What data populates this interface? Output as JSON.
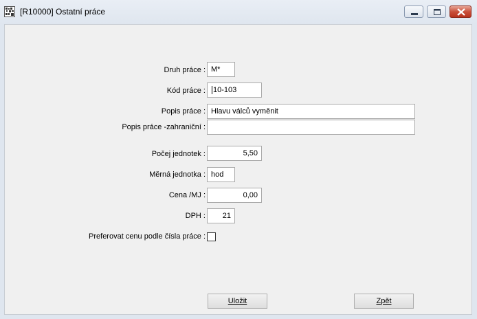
{
  "window": {
    "title": "[R10000] Ostatní práce",
    "controls": {
      "minimize": "minimize-icon",
      "maximize": "maximize-icon",
      "close": "close-icon"
    }
  },
  "form": {
    "druh_prace": {
      "label": "Druh práce :",
      "value": "M*"
    },
    "kod_prace": {
      "label": "Kód práce :",
      "value": "10-103"
    },
    "popis_prace": {
      "label": "Popis práce :",
      "value": "Hlavu válců vyměnit"
    },
    "popis_zahranicni": {
      "label": "Popis práce -zahraniční :",
      "value": ""
    },
    "pocet_jednotek": {
      "label": "Počej jednotek :",
      "value": "5,50"
    },
    "merna_jednotka": {
      "label": "Měrná jednotka :",
      "value": "hod"
    },
    "cena_mj": {
      "label": "Cena /MJ :",
      "value": "0,00"
    },
    "dph": {
      "label": "DPH :",
      "value": "21"
    },
    "preferovat": {
      "label": "Preferovat cenu podle čísla práce :",
      "checked": false
    }
  },
  "buttons": {
    "save": "Uložit",
    "back": "Zpět"
  }
}
